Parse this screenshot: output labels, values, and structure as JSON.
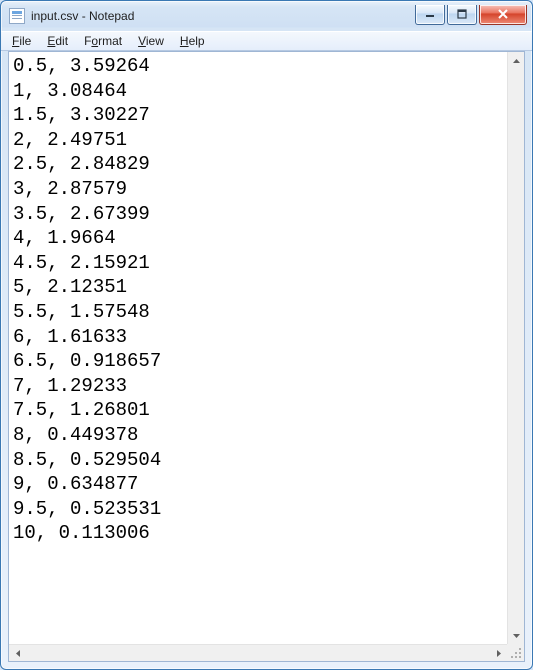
{
  "window": {
    "title": "input.csv - Notepad"
  },
  "menu": {
    "file": "File",
    "edit": "Edit",
    "format": "Format",
    "view": "View",
    "help": "Help"
  },
  "content_lines": [
    "0.5, 3.59264",
    "1, 3.08464",
    "1.5, 3.30227",
    "2, 2.49751",
    "2.5, 2.84829",
    "3, 2.87579",
    "3.5, 2.67399",
    "4, 1.9664",
    "4.5, 2.15921",
    "5, 2.12351",
    "5.5, 1.57548",
    "6, 1.61633",
    "6.5, 0.918657",
    "7, 1.29233",
    "7.5, 1.26801",
    "8, 0.449378",
    "8.5, 0.529504",
    "9, 0.634877",
    "9.5, 0.523531",
    "10, 0.113006"
  ]
}
